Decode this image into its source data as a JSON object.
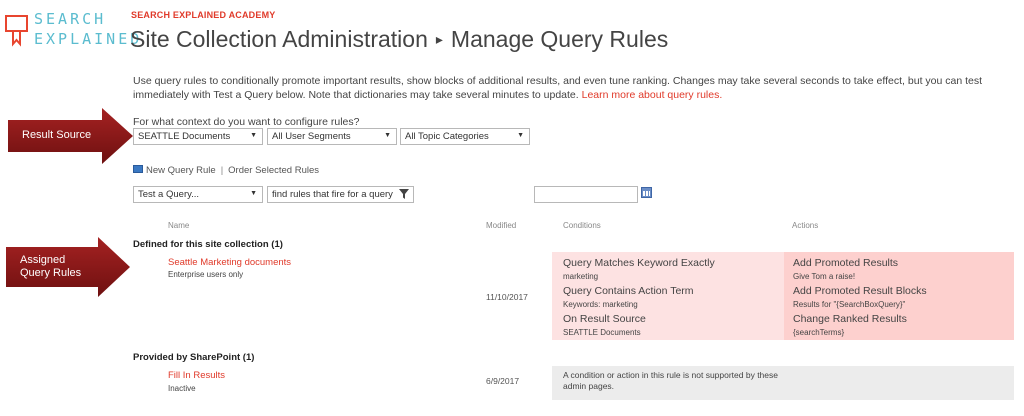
{
  "logo": {
    "line1": "SEARCH",
    "line2": "EXPLAINED",
    "color": "#5bbccf",
    "icon": "monitor-ribbon-icon"
  },
  "header": {
    "academy": "SEARCH EXPLAINED ACADEMY",
    "breadcrumb_parent": "Site Collection Administration",
    "breadcrumb_separator": "▸",
    "page_title": "Manage Query Rules"
  },
  "intro": {
    "text": "Use query rules to conditionally promote important results, show blocks of additional results, and even tune ranking. Changes may take several seconds to take effect, but you can test immediately with Test a Query below. Note that dictionaries may take several minutes to update. ",
    "link": "Learn more about query rules."
  },
  "context": {
    "label": "For what context do you want to configure rules?",
    "result_source": "SEATTLE Documents",
    "user_segments": "All User Segments",
    "topic_categories": "All Topic Categories"
  },
  "toolbar": {
    "new_rule": "New Query Rule",
    "separator": "|",
    "order_rules": "Order Selected Rules"
  },
  "filters": {
    "test_query": "Test a Query...",
    "find_rules": "find rules that fire for a query"
  },
  "columns": {
    "name": "Name",
    "modified": "Modified",
    "conditions": "Conditions",
    "actions": "Actions"
  },
  "groups": [
    {
      "title": "Defined for this site collection (1)",
      "rules": [
        {
          "name": "Seattle Marketing documents",
          "sub": "Enterprise users only",
          "modified": "11/10/2017",
          "conditions": [
            {
              "title": "Query Matches Keyword Exactly",
              "sub": "marketing"
            },
            {
              "title": "Query Contains Action Term",
              "sub": "Keywords: marketing"
            },
            {
              "title": "On Result Source",
              "sub": "SEATTLE Documents"
            }
          ],
          "actions": [
            {
              "title": "Add Promoted Results",
              "sub": "Give Tom a raise!"
            },
            {
              "title": "Add Promoted Result Blocks",
              "sub": "Results for \"{SearchBoxQuery}\""
            },
            {
              "title": "Change Ranked Results",
              "sub": "{searchTerms}"
            }
          ]
        }
      ]
    },
    {
      "title": "Provided by SharePoint (1)",
      "rules": [
        {
          "name": "Fill In Results",
          "sub": "Inactive",
          "modified": "6/9/2017",
          "note": "A condition or action in this rule is not supported by these admin pages."
        }
      ]
    }
  ],
  "callouts": {
    "result_source": "Result Source",
    "assigned_line1": "Assigned",
    "assigned_line2": "Query Rules",
    "color": "#8b1a1a"
  },
  "colors": {
    "accent": "#e03a2a",
    "conditions_bg": "#fde2e2",
    "actions_bg": "#fdd0ce",
    "inactive_bg": "#ececec"
  }
}
